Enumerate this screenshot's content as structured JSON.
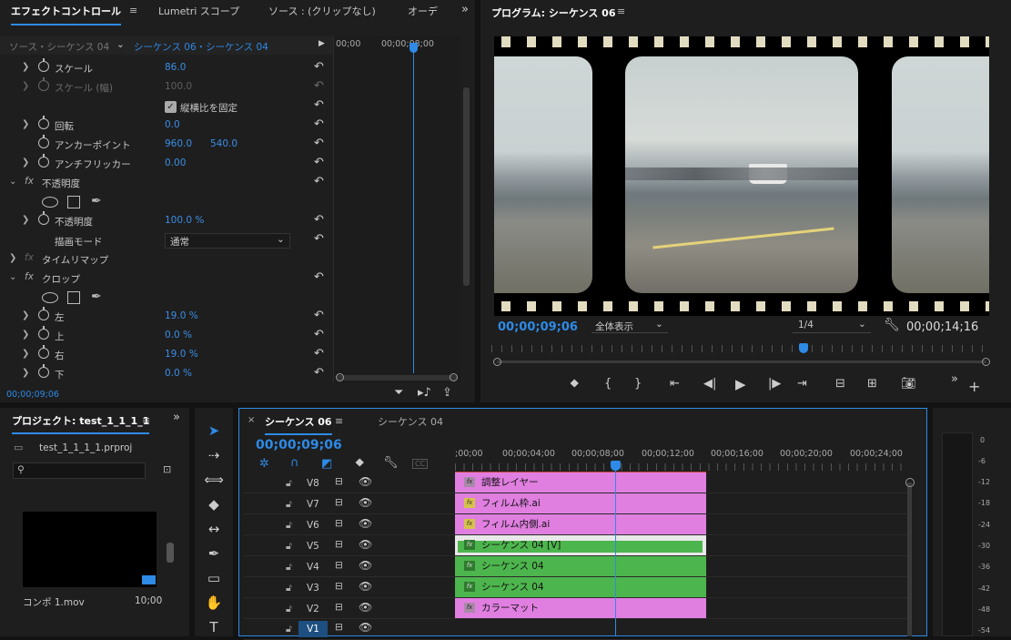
{
  "effect_controls": {
    "tabs": [
      "エフェクトコントロール",
      "Lumetri スコープ",
      "ソース : (クリップなし)",
      "オーデ"
    ],
    "source_label": "ソース・シーケンス 04",
    "sequence_label": "シーケンス 06・シーケンス 04",
    "ruler": [
      "00;00",
      "00;00;08;00"
    ],
    "timecode": "00;00;09;06",
    "properties": {
      "scale": {
        "name": "スケール",
        "value": "86.0"
      },
      "scale_width": {
        "name": "スケール (幅)",
        "value": "100.0"
      },
      "uniform": {
        "name": "縦横比を固定"
      },
      "rotation": {
        "name": "回転",
        "value": "0.0"
      },
      "anchor": {
        "name": "アンカーポイント",
        "x": "960.0",
        "y": "540.0"
      },
      "antiflicker": {
        "name": "アンチフリッカー",
        "value": "0.00"
      },
      "opacity_group": {
        "name": "不透明度"
      },
      "opacity": {
        "name": "不透明度",
        "value": "100.0 %"
      },
      "blend": {
        "name": "描画モード",
        "value": "通常"
      },
      "timeremap": {
        "name": "タイムリマップ"
      },
      "crop": {
        "name": "クロップ"
      },
      "left": {
        "name": "左",
        "value": "19.0 %"
      },
      "top": {
        "name": "上",
        "value": "0.0 %"
      },
      "right": {
        "name": "右",
        "value": "19.0 %"
      },
      "bottom": {
        "name": "下",
        "value": "0.0 %"
      }
    }
  },
  "program": {
    "title": "プログラム: シーケンス 06",
    "timecode": "00;00;09;06",
    "zoom": "全体表示",
    "resolution": "1/4",
    "duration": "00;00;14;16"
  },
  "project": {
    "title": "プロジェクト: test_1_1_1_1",
    "file": "test_1_1_1_1.prproj",
    "clip_name": "コンポ 1.mov",
    "clip_duration": "10;00"
  },
  "timeline": {
    "tabs": [
      "シーケンス 06",
      "シーケンス 04"
    ],
    "timecode": "00;00;09;06",
    "ruler": [
      ";00;00",
      "00;00;04;00",
      "00;00;08;00",
      "00;00;12;00",
      "00;00;16;00",
      "00;00;20;00",
      "00;00;24;00"
    ],
    "tracks": [
      "V8",
      "V7",
      "V6",
      "V5",
      "V4",
      "V3",
      "V2",
      "V1"
    ],
    "clips": [
      "調整レイヤー",
      "フィルム枠.ai",
      "フィルム内側.ai",
      "シーケンス 04 [V]",
      "シーケンス 04",
      "シーケンス 04",
      "カラーマット"
    ],
    "cc": "CC"
  },
  "meter": [
    "0",
    "-6",
    "-12",
    "-18",
    "-24",
    "-30",
    "-36",
    "-42",
    "-48",
    "-54"
  ],
  "colors": {
    "accent": "#2e8ae6",
    "clip_pink": "#e07fe0",
    "clip_green": "#4db54d"
  }
}
